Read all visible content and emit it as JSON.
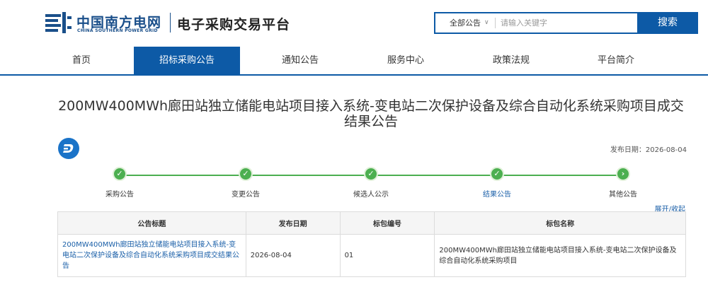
{
  "header": {
    "logo_cn": "中国南方电网",
    "logo_en": "CHINA SOUTHERN POWER GRID",
    "platform_name": "电子采购交易平台",
    "logo_mark_icon": "csg-logo-mark-icon"
  },
  "search": {
    "scope_value": "全部公告",
    "placeholder": "请输入关键字",
    "button_label": "搜索",
    "chevron_icon": "chevron-down-icon"
  },
  "nav": {
    "items": [
      "首页",
      "招标采购公告",
      "通知公告",
      "服务中心",
      "政策法规",
      "平台简介"
    ],
    "active_index": 1,
    "active_color": "#0d5aa6"
  },
  "notice": {
    "title": "200MW400MWh廊田站独立储能电站项目接入系统-变电站二次保护设备及综合自动化系统采购项目成交结果公告",
    "publish_date_label": "发布日期：2026-08-04",
    "badge_icon": "dash-logo-icon"
  },
  "progress": {
    "color": "#4caf50",
    "steps": [
      {
        "label": "采购公告",
        "icon": "check-icon",
        "glyph": "✓"
      },
      {
        "label": "变更公告",
        "icon": "check-icon",
        "glyph": "✓"
      },
      {
        "label": "候选人公示",
        "icon": "check-icon",
        "glyph": "✓"
      },
      {
        "label": "结果公告",
        "icon": "check-icon",
        "glyph": "✓"
      },
      {
        "label": "其他公告",
        "icon": "chevron-right-icon",
        "glyph": "›"
      }
    ],
    "current_index": 3
  },
  "toggle_label": "展开/收起",
  "table": {
    "headers": [
      "公告标题",
      "发布日期",
      "标包编号",
      "标包名称"
    ],
    "rows": [
      {
        "title": "200MW400MWh廊田站独立储能电站项目接入系统-变电站二次保护设备及综合自动化系统采购项目成交结果公告",
        "date": "2026-08-04",
        "package_no": "01",
        "package_name": "200MW400MWh廊田站独立储能电站项目接入系统-变电站二次保护设备及综合自动化系统采购项目"
      }
    ]
  }
}
